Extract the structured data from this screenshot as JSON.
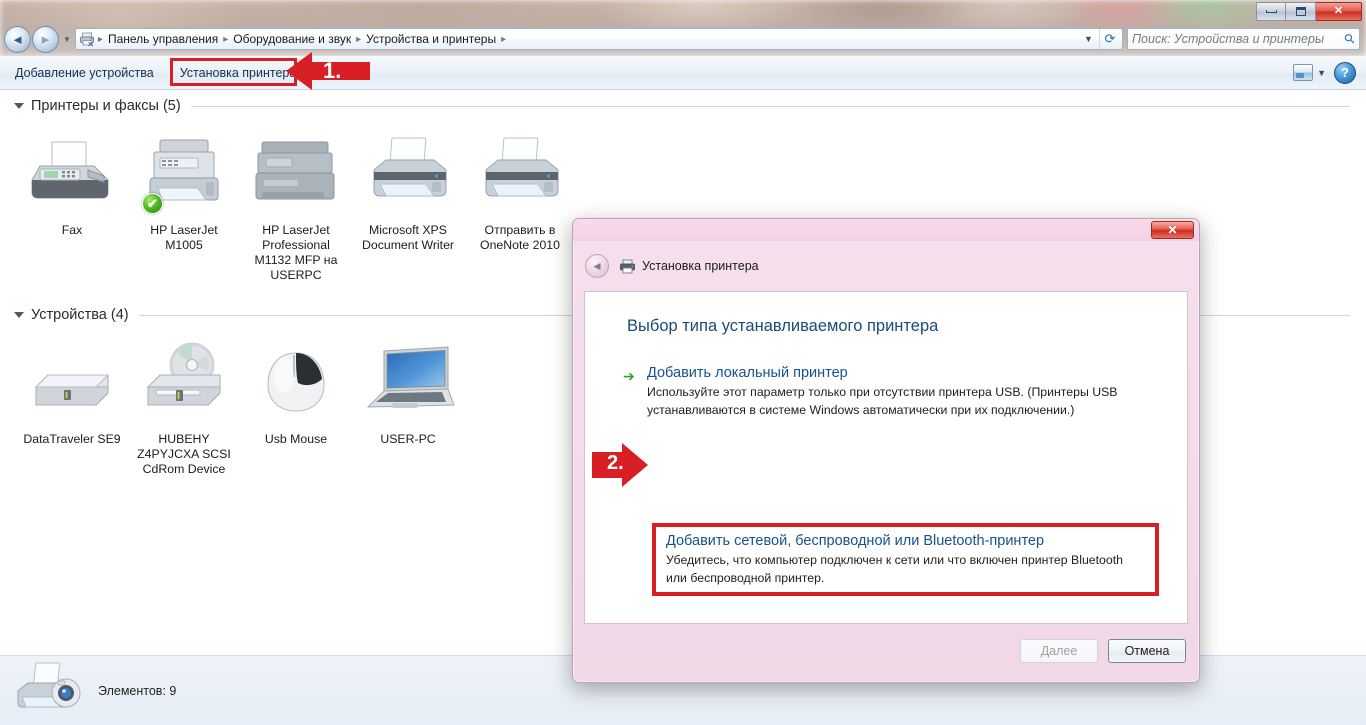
{
  "window": {
    "minimize_label": "Свернуть",
    "maximize_label": "Развернуть",
    "close_label": "Закрыть",
    "close_glyph": "✕"
  },
  "nav": {
    "back_glyph": "◄",
    "forward_glyph": "►",
    "history_caret": "▼",
    "address_icon": "printer-icon",
    "breadcrumbs": [
      "Панель управления",
      "Оборудование и звук",
      "Устройства и принтеры"
    ],
    "separator": "▸",
    "dropdown_caret": "▼",
    "refresh_glyph": "⟳"
  },
  "search": {
    "placeholder": "Поиск: Устройства и принтеры",
    "icon_glyph": "⚲"
  },
  "toolbar": {
    "items": [
      {
        "label": "Добавление устройства",
        "name": "add-device-button"
      },
      {
        "label": "Установка принтера",
        "name": "add-printer-button"
      }
    ],
    "view_caret": "▼",
    "help_glyph": "?"
  },
  "content": {
    "sections": [
      {
        "title": "Принтеры и факсы (5)",
        "name": "printers-section",
        "items": [
          {
            "label": "Fax",
            "icon": "fax-machine-icon",
            "default": false
          },
          {
            "label": "HP LaserJet M1005",
            "icon": "printer-mfp-icon",
            "default": true
          },
          {
            "label": "HP LaserJet Professional M1132 MFP на USERPC",
            "icon": "printer-mfp-network-icon",
            "default": false
          },
          {
            "label": "Microsoft XPS Document Writer",
            "icon": "printer-icon",
            "default": false
          },
          {
            "label": "Отправить в OneNote 2010",
            "icon": "printer-icon",
            "default": false
          }
        ]
      },
      {
        "title": "Устройства (4)",
        "name": "devices-section",
        "items": [
          {
            "label": "DataTraveler SE9",
            "icon": "usb-drive-icon",
            "default": false
          },
          {
            "label": "HUBEHY Z4PYJCXA SCSI CdRom Device",
            "icon": "cdrom-drive-icon",
            "default": false
          },
          {
            "label": "Usb Mouse",
            "icon": "mouse-icon",
            "default": false
          },
          {
            "label": "USER-PC",
            "icon": "laptop-icon",
            "default": false
          }
        ]
      }
    ],
    "default_badge_glyph": "✔"
  },
  "statusbar": {
    "icon": "printer-camera-icon",
    "text": "Элементов: 9"
  },
  "dialog": {
    "title": "Установка принтера",
    "title_icon": "printer-icon",
    "back_glyph": "◄",
    "close_glyph": "✕",
    "heading": "Выбор типа устанавливаемого принтера",
    "options": [
      {
        "name": "add-local-printer-option",
        "arrow_glyph": "➔",
        "title": "Добавить локальный принтер",
        "desc": "Используйте этот параметр только при отсутствии принтера USB. (Принтеры USB устанавливаются в системе Windows автоматически при их подключении.)"
      },
      {
        "name": "add-network-printer-option",
        "arrow_glyph": "➔",
        "title": "Добавить сетевой, беспроводной или Bluetooth-принтер",
        "desc": "Убедитесь, что компьютер подключен к сети или что включен принтер Bluetooth или беспроводной принтер."
      }
    ],
    "buttons": {
      "next": "Далее",
      "cancel": "Отмена"
    }
  },
  "annotations": [
    {
      "name": "step-1-marker",
      "label": "1.",
      "color": "#d81f26"
    },
    {
      "name": "step-2-marker",
      "label": "2.",
      "color": "#d81f26"
    }
  ],
  "colors": {
    "annotation_red": "#d81f26",
    "dialog_pink": "#f2d2e5",
    "link_blue": "#15538c",
    "heading_blue": "#1b4a7a",
    "default_badge_green": "#49b81e"
  }
}
